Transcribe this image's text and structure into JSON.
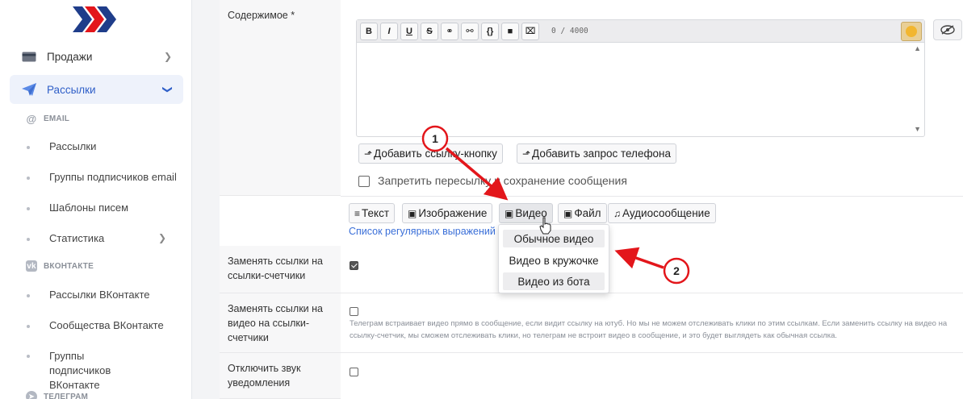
{
  "sidebar": {
    "nav": [
      {
        "label": "Продажи",
        "icon": "card-icon"
      },
      {
        "label": "Рассылки",
        "icon": "paper-plane-icon"
      }
    ],
    "sections": [
      {
        "label": "EMAIL",
        "icon": "at-icon"
      },
      {
        "label": "ВКОНТАКТЕ",
        "icon": "vk-icon"
      },
      {
        "label": "ТЕЛЕГРАМ",
        "icon": "telegram-icon"
      }
    ],
    "email_items": [
      "Рассылки",
      "Группы подписчиков email",
      "Шаблоны писем",
      "Статистика"
    ],
    "vk_items": [
      "Рассылки ВКонтакте",
      "Сообщества ВКонтакте",
      "Группы подписчиков ВКонтакте"
    ]
  },
  "form": {
    "content_label": "Содержимое *",
    "counter": "0 / 4000",
    "toolbar_buttons": [
      "B",
      "I",
      "U",
      "S",
      "⚭",
      "⚯",
      "{}",
      "■",
      "⌧"
    ],
    "add_link_button": "Добавить ссылку-кнопку",
    "add_phone_button": "Добавить запрос телефона",
    "forbid_forward_label": "Запретить пересылку и сохранение сообщения",
    "attach_buttons": [
      {
        "label": "Текст",
        "icon": "≡"
      },
      {
        "label": "Изображение",
        "icon": "▣"
      },
      {
        "label": "Видео",
        "icon": "▣"
      },
      {
        "label": "Файл",
        "icon": "▣"
      },
      {
        "label": "Аудиосообщение",
        "icon": "♫"
      }
    ],
    "regex_link": "Список регулярных выражений",
    "replace_links_label": "Заменять ссылки на ссылки-счетчики",
    "replace_video_label": "Заменять ссылки на видео на ссылки-счетчики",
    "replace_video_help": "Телеграм встраивает видео прямо в сообщение, если видит ссылку на ютуб. Но мы не можем отслеживать клики по этим ссылкам. Если заменить ссылку на видео на ссылку-счетчик, мы сможем отслеживать клики, но телеграм не встроит видео в сообщение, и это будет выглядеть как обычная ссылка.",
    "mute_label": "Отключить звук уведомления"
  },
  "dropdown": {
    "options": [
      "Обычное видео",
      "Видео в кружочке",
      "Видео из бота"
    ]
  },
  "annotations": {
    "marker1": "1",
    "marker2": "2"
  },
  "colors": {
    "accent": "#2f5fc8",
    "annotation": "#e3161b",
    "logo_blue": "#1f3d8a",
    "logo_red": "#e3161b"
  }
}
